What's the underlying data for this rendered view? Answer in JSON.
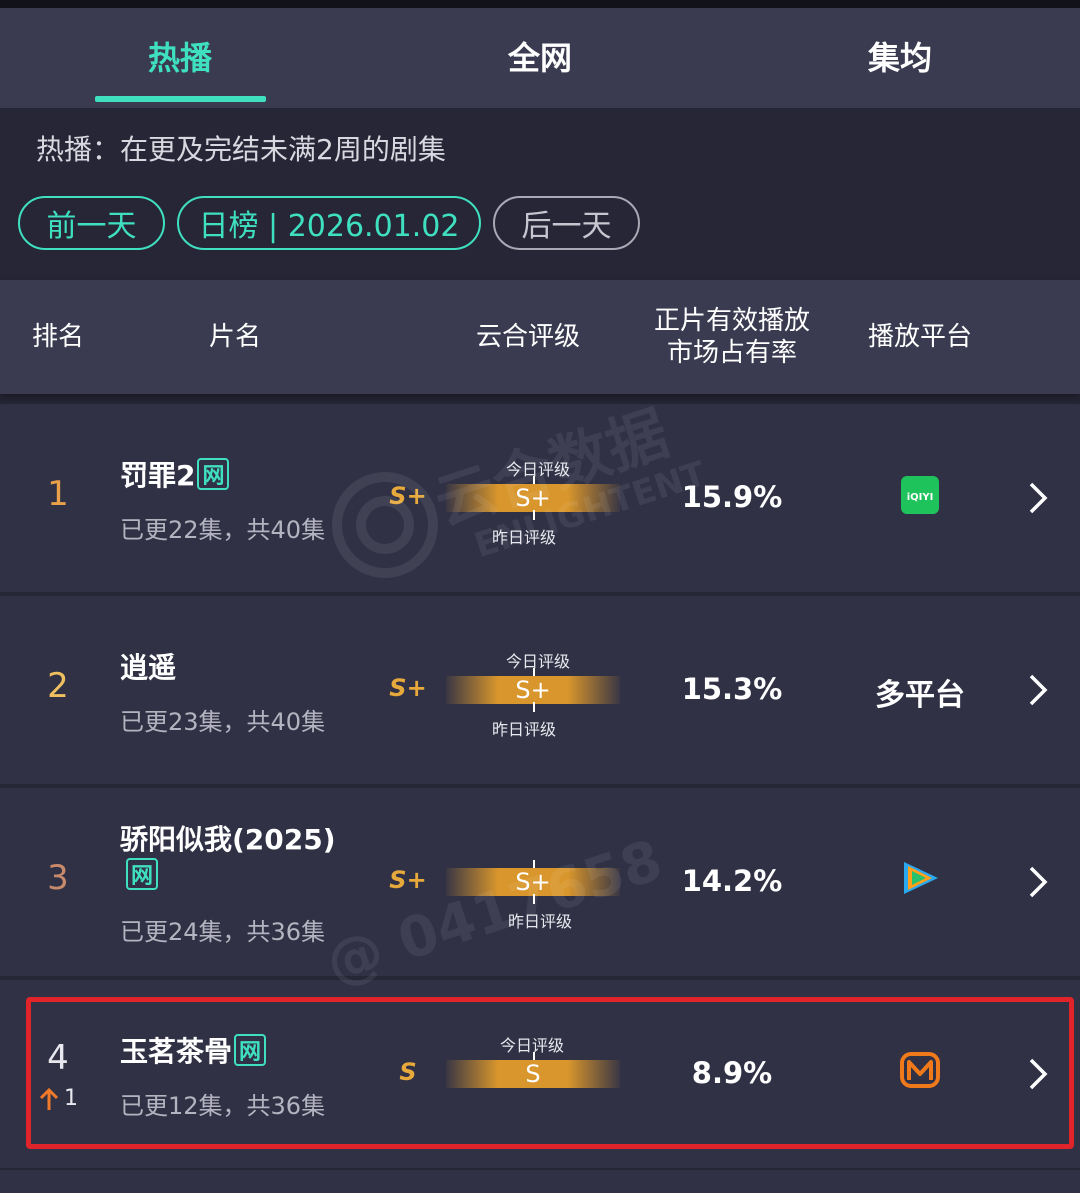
{
  "tabs": [
    {
      "label": "热播",
      "active": true
    },
    {
      "label": "全网",
      "active": false
    },
    {
      "label": "集均",
      "active": false
    }
  ],
  "subtitle": "热播：在更及完结未满2周的剧集",
  "date_nav": {
    "prev": "前一天",
    "current": "日榜 | 2026.01.02",
    "next": "后一天"
  },
  "table_header": {
    "rank": "排名",
    "title": "片名",
    "rating": "云合评级",
    "share_line1": "正片有效播放",
    "share_line2": "市场占有率",
    "platform": "播放平台"
  },
  "rows": [
    {
      "rank": "1",
      "title": "罚罪2",
      "net_badge": "网",
      "episodes": "已更22集，共40集",
      "grade": "S+",
      "bar_grade": "S+",
      "today_label": "今日评级",
      "yesterday_label": "昨日评级",
      "share": "15.9%",
      "platform": {
        "type": "icon",
        "name": "iqiyi-icon",
        "text": "iQIYI"
      }
    },
    {
      "rank": "2",
      "title": "逍遥",
      "net_badge": "",
      "episodes": "已更23集，共40集",
      "grade": "S+",
      "bar_grade": "S+",
      "today_label": "今日评级",
      "yesterday_label": "昨日评级",
      "share": "15.3%",
      "platform": {
        "type": "text",
        "text": "多平台"
      }
    },
    {
      "rank": "3",
      "title": "骄阳似我(2025)",
      "net_badge": "网",
      "episodes": "已更24集，共36集",
      "grade": "S+",
      "bar_grade": "S+",
      "today_label": "",
      "yesterday_label": "昨日评级",
      "share": "14.2%",
      "platform": {
        "type": "icon",
        "name": "tencent-video-icon"
      }
    },
    {
      "rank": "4",
      "rank_change": "1",
      "title": "玉茗茶骨",
      "net_badge": "网",
      "episodes": "已更12集，共36集",
      "grade": "S",
      "bar_grade": "S",
      "today_label": "今日评级",
      "yesterday_label": "",
      "share": "8.9%",
      "platform": {
        "type": "icon",
        "name": "mango-tv-icon"
      }
    }
  ],
  "watermark": {
    "line1": "云合数据",
    "line2": "ENLIGHTENT",
    "line3": "@ 0417658"
  },
  "colors": {
    "accent": "#3fe0c0",
    "grade": "#e7a93c",
    "highlight": "#e0242a",
    "rank1": "#e8a04a",
    "rank2": "#f0c060",
    "rank3": "#c88a6a"
  }
}
